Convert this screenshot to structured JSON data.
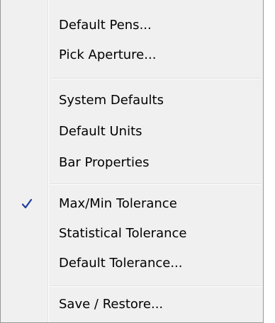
{
  "menu": {
    "items": [
      {
        "label": "Default Pens...",
        "checked": false
      },
      {
        "label": "Pick Aperture...",
        "checked": false
      },
      {
        "label": "System Defaults",
        "checked": false
      },
      {
        "label": "Default Units",
        "checked": false
      },
      {
        "label": "Bar Properties",
        "checked": false
      },
      {
        "label": "Max/Min Tolerance",
        "checked": true
      },
      {
        "label": "Statistical Tolerance",
        "checked": false
      },
      {
        "label": "Default Tolerance...",
        "checked": false
      },
      {
        "label": "Save / Restore...",
        "checked": false
      }
    ],
    "check_icon": "checkmark-icon",
    "check_color": "#1e3c9a"
  }
}
